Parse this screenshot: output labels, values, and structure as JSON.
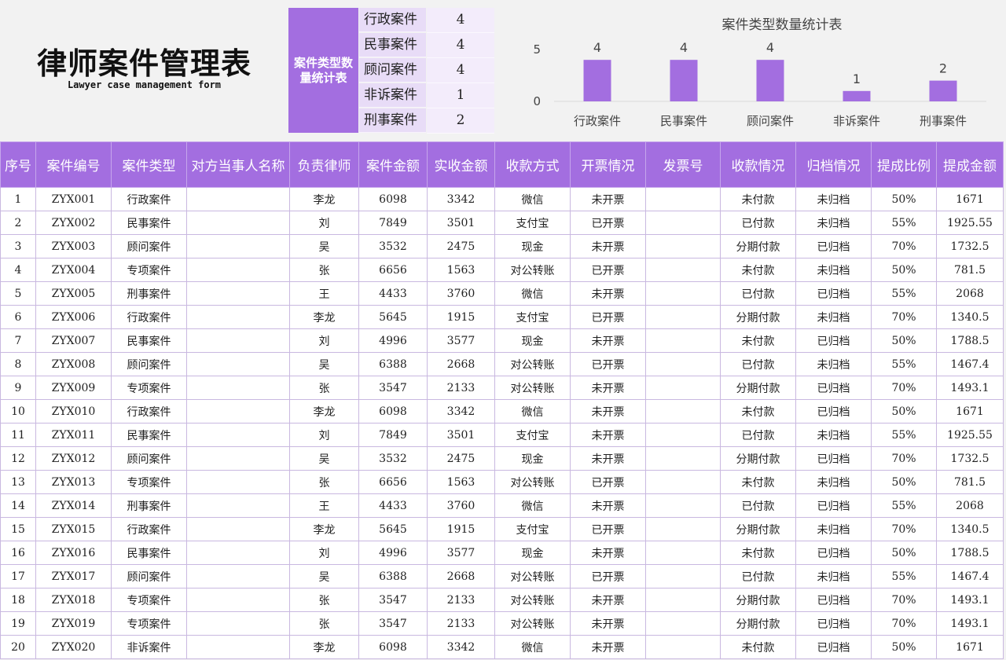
{
  "title": {
    "main": "律师案件管理表",
    "sub": "Lawyer case management form"
  },
  "stats": {
    "label": "案件类型数量统计表",
    "rows": [
      {
        "name": "行政案件",
        "count": "4"
      },
      {
        "name": "民事案件",
        "count": "4"
      },
      {
        "name": "顾问案件",
        "count": "4"
      },
      {
        "name": "非诉案件",
        "count": "1"
      },
      {
        "name": "刑事案件",
        "count": "2"
      }
    ]
  },
  "chart_data": {
    "type": "bar",
    "title": "案件类型数量统计表",
    "categories": [
      "行政案件",
      "民事案件",
      "顾问案件",
      "非诉案件",
      "刑事案件"
    ],
    "values": [
      4,
      4,
      4,
      1,
      2
    ],
    "ylim": [
      0,
      5
    ],
    "yticks": [
      "0",
      "5"
    ],
    "bar_color": "#a36ee0",
    "grid": false,
    "legend": "none"
  },
  "colors": {
    "header": "#a36ee0",
    "stat_name_bg": "#e8dcf7",
    "stat_val_bg": "#f3ecfb"
  },
  "table": {
    "headers": [
      "序号",
      "案件编号",
      "案件类型",
      "对方当事人名称",
      "负责律师",
      "案件金额",
      "实收金额",
      "收款方式",
      "开票情况",
      "发票号",
      "收款情况",
      "归档情况",
      "提成比例",
      "提成金额"
    ],
    "rows": [
      [
        "1",
        "ZYX001",
        "行政案件",
        "",
        "李龙",
        "6098",
        "3342",
        "微信",
        "未开票",
        "",
        "未付款",
        "未归档",
        "50%",
        "1671"
      ],
      [
        "2",
        "ZYX002",
        "民事案件",
        "",
        "刘",
        "7849",
        "3501",
        "支付宝",
        "已开票",
        "",
        "已付款",
        "未归档",
        "55%",
        "1925.55"
      ],
      [
        "3",
        "ZYX003",
        "顾问案件",
        "",
        "吴",
        "3532",
        "2475",
        "现金",
        "未开票",
        "",
        "分期付款",
        "已归档",
        "70%",
        "1732.5"
      ],
      [
        "4",
        "ZYX004",
        "专项案件",
        "",
        "张",
        "6656",
        "1563",
        "对公转账",
        "已开票",
        "",
        "未付款",
        "未归档",
        "50%",
        "781.5"
      ],
      [
        "5",
        "ZYX005",
        "刑事案件",
        "",
        "王",
        "4433",
        "3760",
        "微信",
        "未开票",
        "",
        "已付款",
        "已归档",
        "55%",
        "2068"
      ],
      [
        "6",
        "ZYX006",
        "行政案件",
        "",
        "李龙",
        "5645",
        "1915",
        "支付宝",
        "已开票",
        "",
        "分期付款",
        "未归档",
        "70%",
        "1340.5"
      ],
      [
        "7",
        "ZYX007",
        "民事案件",
        "",
        "刘",
        "4996",
        "3577",
        "现金",
        "未开票",
        "",
        "未付款",
        "已归档",
        "50%",
        "1788.5"
      ],
      [
        "8",
        "ZYX008",
        "顾问案件",
        "",
        "吴",
        "6388",
        "2668",
        "对公转账",
        "已开票",
        "",
        "已付款",
        "未归档",
        "55%",
        "1467.4"
      ],
      [
        "9",
        "ZYX009",
        "专项案件",
        "",
        "张",
        "3547",
        "2133",
        "对公转账",
        "未开票",
        "",
        "分期付款",
        "已归档",
        "70%",
        "1493.1"
      ],
      [
        "10",
        "ZYX010",
        "行政案件",
        "",
        "李龙",
        "6098",
        "3342",
        "微信",
        "未开票",
        "",
        "未付款",
        "已归档",
        "50%",
        "1671"
      ],
      [
        "11",
        "ZYX011",
        "民事案件",
        "",
        "刘",
        "7849",
        "3501",
        "支付宝",
        "未开票",
        "",
        "已付款",
        "未归档",
        "55%",
        "1925.55"
      ],
      [
        "12",
        "ZYX012",
        "顾问案件",
        "",
        "吴",
        "3532",
        "2475",
        "现金",
        "未开票",
        "",
        "分期付款",
        "已归档",
        "70%",
        "1732.5"
      ],
      [
        "13",
        "ZYX013",
        "专项案件",
        "",
        "张",
        "6656",
        "1563",
        "对公转账",
        "已开票",
        "",
        "未付款",
        "未归档",
        "50%",
        "781.5"
      ],
      [
        "14",
        "ZYX014",
        "刑事案件",
        "",
        "王",
        "4433",
        "3760",
        "微信",
        "未开票",
        "",
        "已付款",
        "已归档",
        "55%",
        "2068"
      ],
      [
        "15",
        "ZYX015",
        "行政案件",
        "",
        "李龙",
        "5645",
        "1915",
        "支付宝",
        "已开票",
        "",
        "分期付款",
        "未归档",
        "70%",
        "1340.5"
      ],
      [
        "16",
        "ZYX016",
        "民事案件",
        "",
        "刘",
        "4996",
        "3577",
        "现金",
        "未开票",
        "",
        "未付款",
        "已归档",
        "50%",
        "1788.5"
      ],
      [
        "17",
        "ZYX017",
        "顾问案件",
        "",
        "吴",
        "6388",
        "2668",
        "对公转账",
        "已开票",
        "",
        "已付款",
        "未归档",
        "55%",
        "1467.4"
      ],
      [
        "18",
        "ZYX018",
        "专项案件",
        "",
        "张",
        "3547",
        "2133",
        "对公转账",
        "未开票",
        "",
        "分期付款",
        "已归档",
        "70%",
        "1493.1"
      ],
      [
        "19",
        "ZYX019",
        "专项案件",
        "",
        "张",
        "3547",
        "2133",
        "对公转账",
        "未开票",
        "",
        "分期付款",
        "已归档",
        "70%",
        "1493.1"
      ],
      [
        "20",
        "ZYX020",
        "非诉案件",
        "",
        "李龙",
        "6098",
        "3342",
        "微信",
        "未开票",
        "",
        "未付款",
        "已归档",
        "50%",
        "1671"
      ]
    ]
  }
}
